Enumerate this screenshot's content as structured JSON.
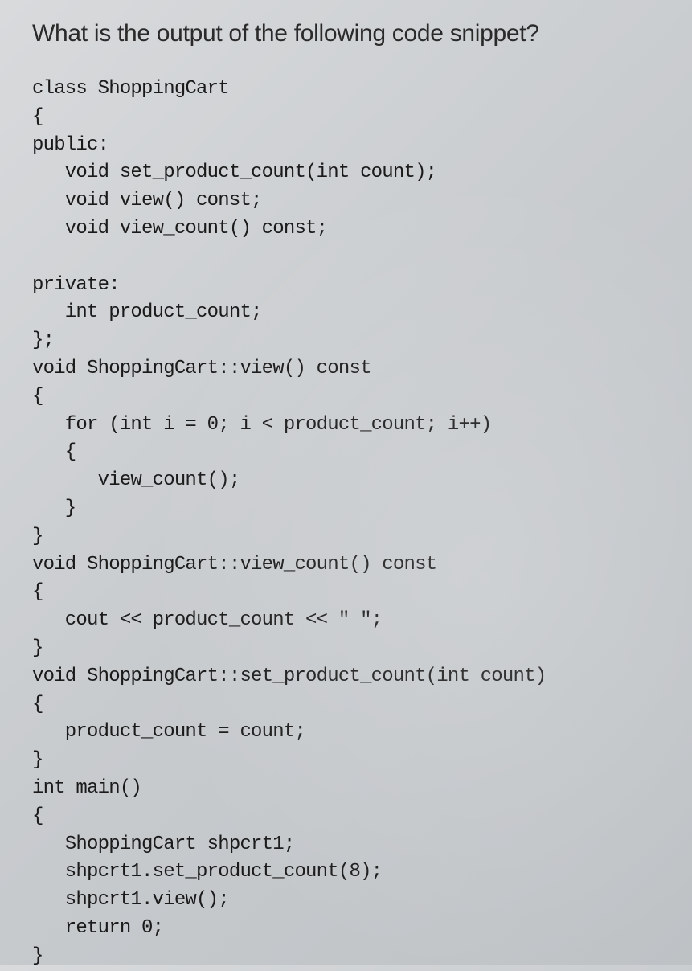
{
  "question": {
    "title": "What is the output of the following code snippet?"
  },
  "code": {
    "lines": [
      "class ShoppingCart",
      "{",
      "public:",
      "   void set_product_count(int count);",
      "   void view() const;",
      "   void view_count() const;",
      "",
      "private:",
      "   int product_count;",
      "};",
      "void ShoppingCart::view() const",
      "{",
      "   for (int i = 0; i < product_count; i++)",
      "   {",
      "      view_count();",
      "   }",
      "}",
      "void ShoppingCart::view_count() const",
      "{",
      "   cout << product_count << \" \";",
      "}",
      "void ShoppingCart::set_product_count(int count)",
      "{",
      "   product_count = count;",
      "}",
      "int main()",
      "{",
      "   ShoppingCart shpcrt1;",
      "   shpcrt1.set_product_count(8);",
      "   shpcrt1.view();",
      "   return 0;",
      "}"
    ]
  }
}
